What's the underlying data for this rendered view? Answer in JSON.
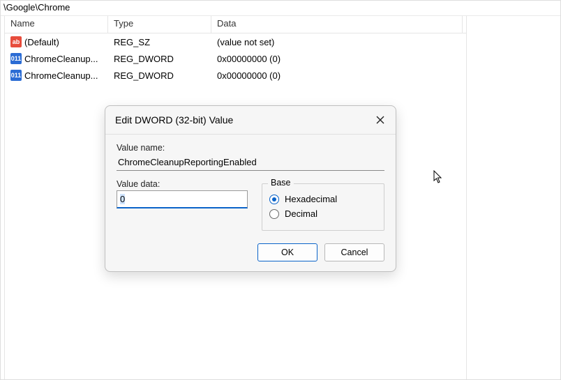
{
  "path": "\\Google\\Chrome",
  "columns": {
    "name": "Name",
    "type": "Type",
    "data": "Data"
  },
  "rows": [
    {
      "icon": "ab",
      "name": "(Default)",
      "type": "REG_SZ",
      "data": "(value not set)"
    },
    {
      "icon": "bin",
      "name": "ChromeCleanup...",
      "type": "REG_DWORD",
      "data": "0x00000000 (0)"
    },
    {
      "icon": "bin",
      "name": "ChromeCleanup...",
      "type": "REG_DWORD",
      "data": "0x00000000 (0)"
    }
  ],
  "dialog": {
    "title": "Edit DWORD (32-bit) Value",
    "value_name_label": "Value name:",
    "value_name": "ChromeCleanupReportingEnabled",
    "value_data_label": "Value data:",
    "value_data": "0",
    "base_label": "Base",
    "radio_hex": "Hexadecimal",
    "radio_dec": "Decimal",
    "base_selected": "hex",
    "ok": "OK",
    "cancel": "Cancel"
  }
}
